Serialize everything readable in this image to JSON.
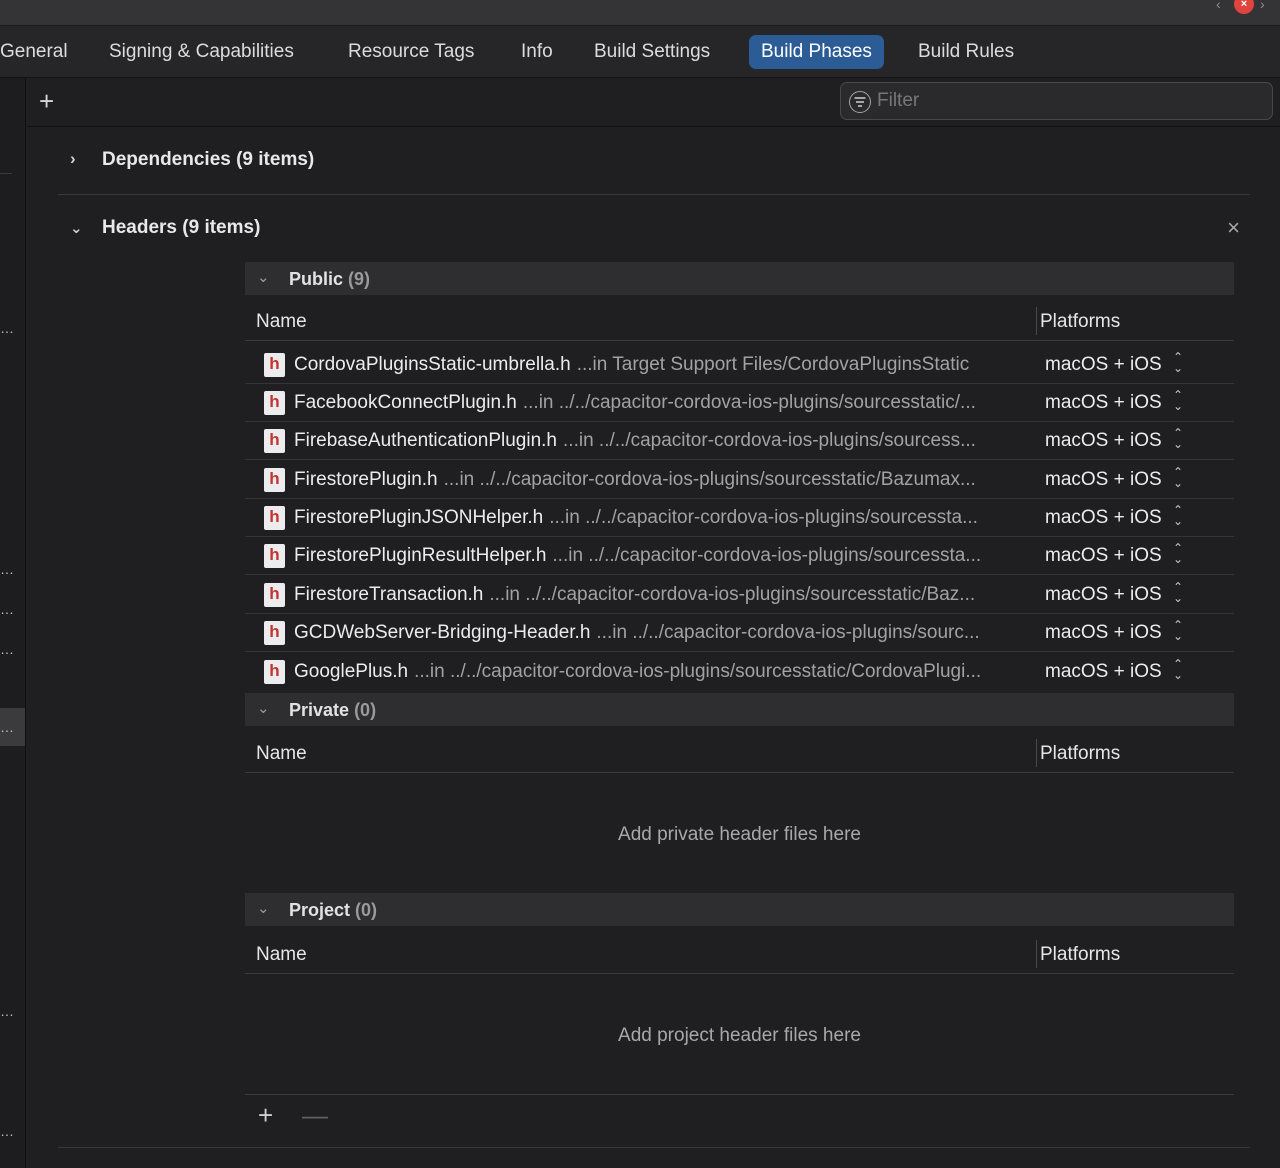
{
  "tabs": [
    {
      "label": "General"
    },
    {
      "label": "Signing & Capabilities"
    },
    {
      "label": "Resource Tags"
    },
    {
      "label": "Info"
    },
    {
      "label": "Build Settings"
    },
    {
      "label": "Build Phases"
    },
    {
      "label": "Build Rules"
    }
  ],
  "active_tab": "Build Phases",
  "toolbar": {
    "add_symbol": "+",
    "filter_placeholder": "Filter"
  },
  "dependencies": {
    "chevron": ">",
    "title": "Dependencies (9 items)"
  },
  "headers": {
    "chevron": "v",
    "title": "Headers (9 items)",
    "close": "×",
    "public": {
      "title": "Public",
      "count": "(9)",
      "col_name": "Name",
      "col_platforms": "Platforms",
      "rows": [
        {
          "name": "CordovaPluginsStatic-umbrella.h",
          "path": "...in Target Support Files/CordovaPluginsStatic",
          "platforms": "macOS + iOS"
        },
        {
          "name": "FacebookConnectPlugin.h",
          "path": "...in ../../capacitor-cordova-ios-plugins/sourcesstatic/...",
          "platforms": "macOS + iOS"
        },
        {
          "name": "FirebaseAuthenticationPlugin.h",
          "path": "...in ../../capacitor-cordova-ios-plugins/sourcess...",
          "platforms": "macOS + iOS"
        },
        {
          "name": "FirestorePlugin.h",
          "path": "...in ../../capacitor-cordova-ios-plugins/sourcesstatic/Bazumax...",
          "platforms": "macOS + iOS"
        },
        {
          "name": "FirestorePluginJSONHelper.h",
          "path": "...in ../../capacitor-cordova-ios-plugins/sourcessta...",
          "platforms": "macOS + iOS"
        },
        {
          "name": "FirestorePluginResultHelper.h",
          "path": "...in ../../capacitor-cordova-ios-plugins/sourcessta...",
          "platforms": "macOS + iOS"
        },
        {
          "name": "FirestoreTransaction.h",
          "path": "...in ../../capacitor-cordova-ios-plugins/sourcesstatic/Baz...",
          "platforms": "macOS + iOS"
        },
        {
          "name": "GCDWebServer-Bridging-Header.h",
          "path": "...in ../../capacitor-cordova-ios-plugins/sourc...",
          "platforms": "macOS + iOS"
        },
        {
          "name": "GooglePlus.h",
          "path": "...in ../../capacitor-cordova-ios-plugins/sourcesstatic/CordovaPlugi...",
          "platforms": "macOS + iOS"
        }
      ]
    },
    "private": {
      "title": "Private",
      "count": "(0)",
      "col_name": "Name",
      "col_platforms": "Platforms",
      "empty_text": "Add private header files here"
    },
    "project": {
      "title": "Project",
      "count": "(0)",
      "col_name": "Name",
      "col_platforms": "Platforms",
      "empty_text": "Add project header files here"
    }
  },
  "footer": {
    "add_symbol": "+",
    "remove_symbol": "—"
  },
  "file_icon_letter": "h",
  "colors": {
    "accent_tab": "#2c5c96",
    "file_icon_letter": "#c4342e",
    "close_button": "#e0443e"
  }
}
